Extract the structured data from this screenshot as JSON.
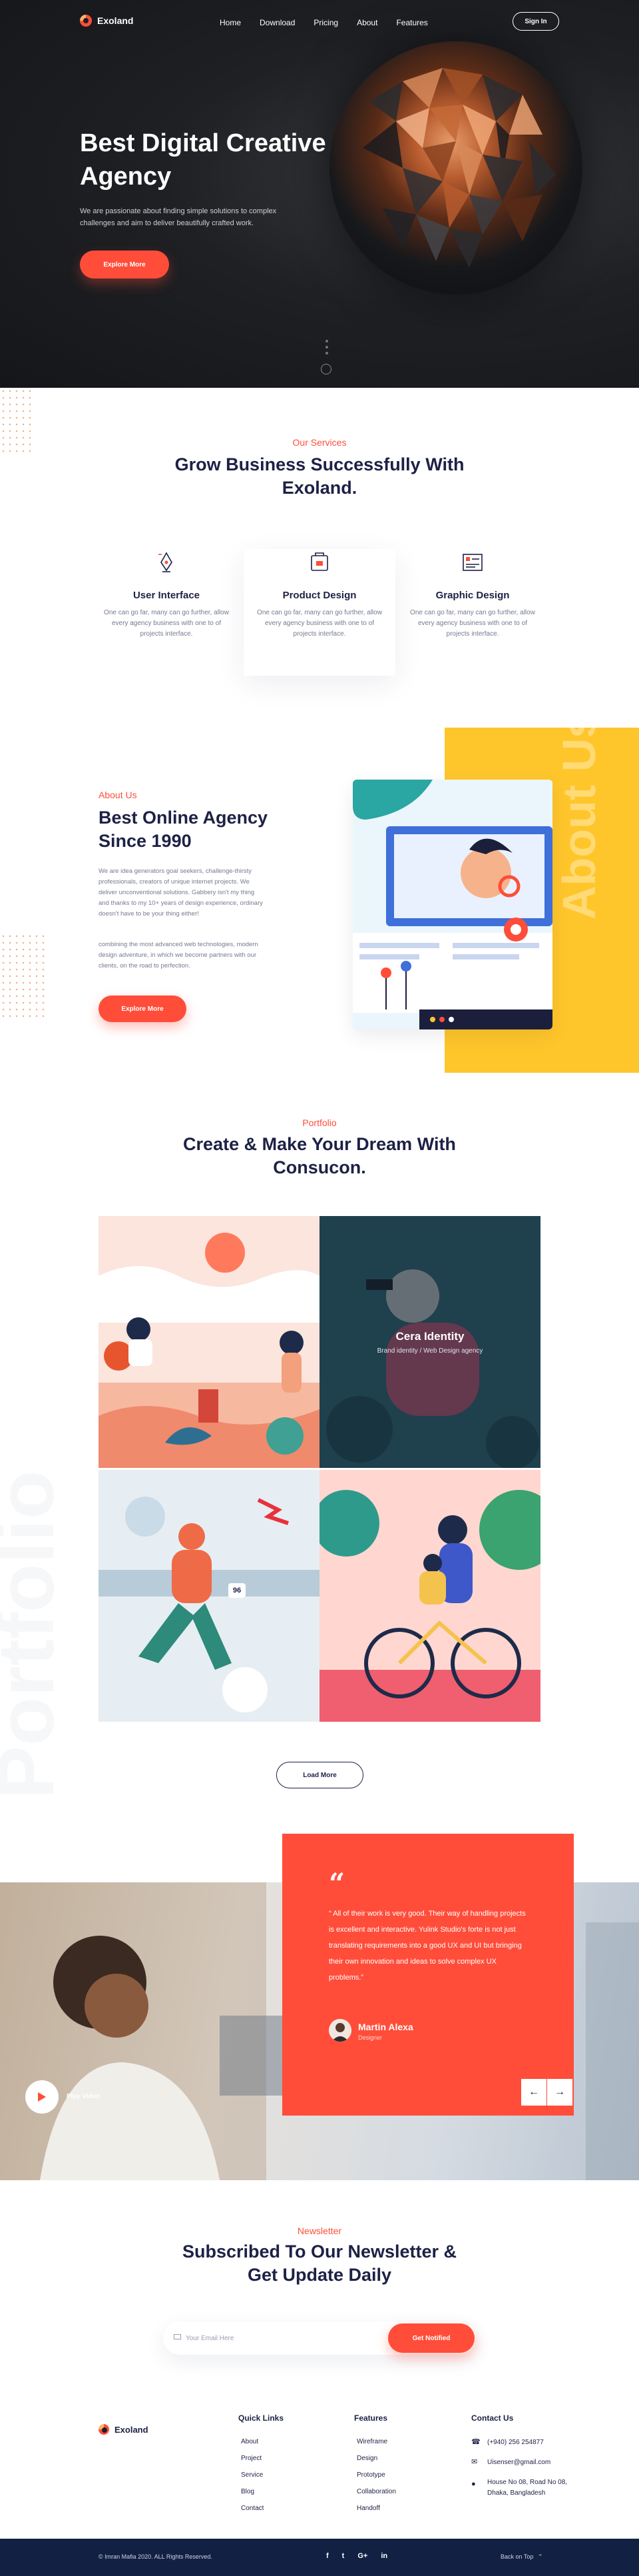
{
  "header": {
    "brand": "Exoland",
    "nav": [
      "Home",
      "Download",
      "Pricing",
      "About",
      "Features"
    ],
    "signin": "Sign In"
  },
  "hero": {
    "title": "Best Digital Creative Agency",
    "subtitle": "We are passionate about finding simple solutions to complex challenges and aim to deliver beautifully crafted work.",
    "cta": "Explore More"
  },
  "services": {
    "eyebrow": "Our Services",
    "title": "Grow Business Successfully With Exoland.",
    "items": [
      {
        "name": "User Interface",
        "desc": "One can go far, many can go further, allow every agency business with one to of projects interface.",
        "icon": "pen-tool-icon"
      },
      {
        "name": "Product Design",
        "desc": "One can go far, many can go further, allow every agency business with one to of projects interface.",
        "icon": "product-design-icon"
      },
      {
        "name": "Graphic Design",
        "desc": "One can go far, many can go further, allow every agency business with one to of projects interface.",
        "icon": "graphic-design-icon"
      }
    ]
  },
  "about": {
    "eyebrow": "About Us",
    "title": "Best Online Agency Since 1990",
    "p1": "We are idea generators goal seekers, challenge-thirsty professionals, creators of unique internet projects. We deliver unconventional solutions. Gabbery isn't my thing and thanks to my 10+ years of design experience, ordinary doesn't have to be your thing either!",
    "p2": "combining the most advanced web technologies, modern design adventure, in which we become partners with our clients, on the road to perfection.",
    "cta": "Explore More",
    "vertical": "About Us"
  },
  "portfolio": {
    "eyebrow": "Portfolio",
    "title": "Create & Make Your Dream With Consucon.",
    "vertical": "Portfolio",
    "hover_title": "Cera Identity",
    "hover_sub": "Brand identity / Web Design agency",
    "badge": "96",
    "load_more": "Load More"
  },
  "testimonial": {
    "quote": "“ All of their work is very good. Their way of handling projects is excellent and interactive. Yulink Studio's forte is not just translating requirements into a good UX and UI but bringing their own innovation and ideas to solve complex UX problems.”",
    "name": "Martin Alexa",
    "role": "Designer",
    "play": "Play Video",
    "prev": "←",
    "next": "→"
  },
  "newsletter": {
    "eyebrow": "Newsletter",
    "title": "Subscribed To Our Newsletter & Get Update Daily",
    "placeholder": "Your Email Here",
    "cta": "Get Notified"
  },
  "footer": {
    "brand": "Exoland",
    "quick_title": "Quick Links",
    "quick": [
      "About",
      "Project",
      "Service",
      "Blog",
      "Contact"
    ],
    "features_title": "Features",
    "features": [
      "Wireframe",
      "Design",
      "Prototype",
      "Collaboration",
      "Handoff"
    ],
    "contact_title": "Contact Us",
    "phone": "(+940) 256 254877",
    "email": "Uisenser@gmail.com",
    "address1": "House No 08, Road No 08,",
    "address2": "Dhaka, Bangladesh",
    "copyright": "© Imran Mafia 2020. ALL Rights Reserved.",
    "social": [
      "f",
      "t",
      "G+",
      "in"
    ],
    "back_top": "Back on Top"
  },
  "colors": {
    "accent": "#ff4d3a",
    "navy": "#1d2145",
    "yellow": "#ffc62b",
    "footer_bar": "#122044"
  }
}
